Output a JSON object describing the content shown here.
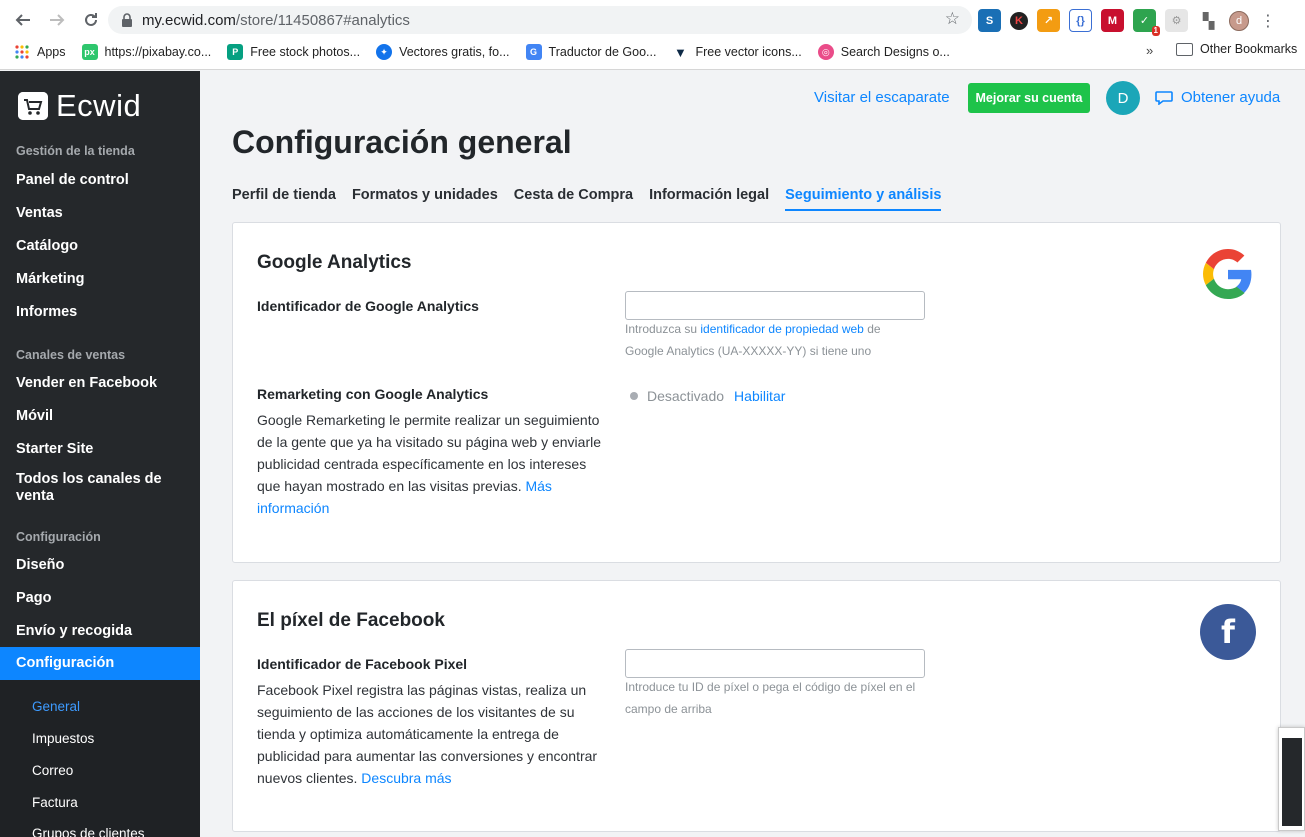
{
  "browser": {
    "url_host": "my.ecwid.com",
    "url_path": "/store/11450867#analytics",
    "profile_initial": "d",
    "extension_badge": "1",
    "bookmarks": [
      {
        "label": "Apps",
        "icon": "apps-grid-icon",
        "color": "#4285f4"
      },
      {
        "label": "https://pixabay.co...",
        "icon": "pixabay-icon",
        "color": "#2ec66d"
      },
      {
        "label": "Free stock photos...",
        "icon": "pexels-icon",
        "color": "#05a081"
      },
      {
        "label": "Vectores gratis, fo...",
        "icon": "freepik-icon",
        "color": "#1273eb"
      },
      {
        "label": "Traductor de Goo...",
        "icon": "google-translate-icon",
        "color": "#4285f4"
      },
      {
        "label": "Free vector icons...",
        "icon": "flaticon-icon",
        "color": "#0e2a47"
      },
      {
        "label": "Search Designs o...",
        "icon": "dribbble-icon",
        "color": "#ea4c89"
      }
    ],
    "bookmarks_more": "»",
    "other_bookmarks": "Other Bookmarks"
  },
  "sidebar": {
    "brand": "Ecwid",
    "sections": {
      "store": "Gestión de la tienda",
      "channels": "Canales de ventas",
      "config": "Configuración"
    },
    "store_items": [
      "Panel de control",
      "Ventas",
      "Catálogo",
      "Márketing",
      "Informes"
    ],
    "channel_items": [
      "Vender en Facebook",
      "Móvil",
      "Starter Site",
      "Todos los canales de venta"
    ],
    "config_items": [
      "Diseño",
      "Pago",
      "Envío y recogida"
    ],
    "active_item": "Configuración",
    "sub_items": [
      "General",
      "Impuestos",
      "Correo",
      "Factura",
      "Grupos de clientes"
    ]
  },
  "topbar": {
    "visit_store": "Visitar el escaparate",
    "upgrade": "Mejorar su cuenta",
    "avatar_initial": "D",
    "help": "Obtener ayuda"
  },
  "page": {
    "title": "Configuración general",
    "tabs": [
      "Perfil de tienda",
      "Formatos y unidades",
      "Cesta de Compra",
      "Información legal",
      "Seguimiento y análisis"
    ],
    "active_tab": "Seguimiento y análisis"
  },
  "google": {
    "title": "Google Analytics",
    "id_label": "Identificador de Google Analytics",
    "id_value": "",
    "hint_prefix": "Introduzca su",
    "hint_link": "identificador de propiedad web",
    "hint_middle": "de",
    "hint_suffix": "Google Analytics (UA-XXXXX-YY) si tiene uno",
    "remarketing_label": "Remarketing con Google Analytics",
    "remarketing_desc": "Google Remarketing le permite realizar un seguimiento de la gente que ya ha visitado su página web y enviarle publicidad centrada específicamente en los intereses que hayan mostrado en las visitas previas.",
    "remarketing_more": "Más información",
    "status": "Desactivado",
    "enable": "Habilitar"
  },
  "facebook": {
    "title": "El píxel de Facebook",
    "id_label": "Identificador de Facebook Pixel",
    "id_value": "",
    "desc": "Facebook Pixel registra las páginas vistas, realiza un seguimiento de las acciones de los visitantes de su tienda y optimiza automáticamente la entrega de publicidad para aumentar las conversiones y encontrar nuevos clientes.",
    "more": "Descubra más",
    "hint": "Introduce tu ID de píxel o pega el código de píxel en el campo de arriba",
    "logo_letter": "f"
  },
  "colors": {
    "accent": "#0d86ff",
    "upgrade_green": "#1ec34a",
    "sidebar_bg": "#25282b",
    "facebook_blue": "#3b5998"
  }
}
